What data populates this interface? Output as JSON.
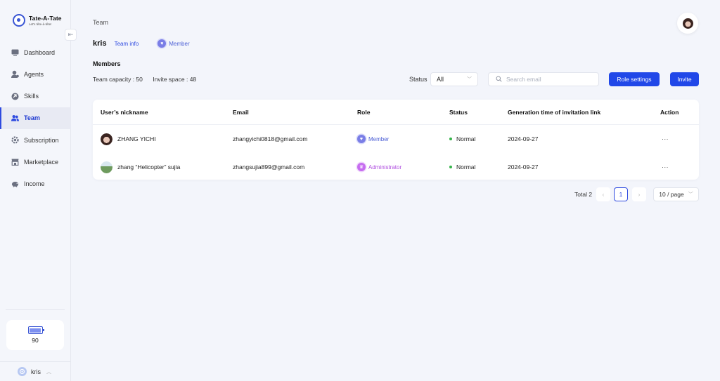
{
  "brand": {
    "title": "Tate-A-Tate",
    "subtitle": "Let's tête-à-tête!",
    "color": "#3a56d4"
  },
  "sidebar": {
    "items": [
      {
        "label": "Dashboard",
        "icon": "dashboard-icon"
      },
      {
        "label": "Agents",
        "icon": "agents-icon"
      },
      {
        "label": "Skills",
        "icon": "skills-icon"
      },
      {
        "label": "Team",
        "icon": "team-icon",
        "active": true
      },
      {
        "label": "Subscription",
        "icon": "subscription-icon"
      },
      {
        "label": "Marketplace",
        "icon": "marketplace-icon"
      },
      {
        "label": "Income",
        "icon": "income-icon"
      }
    ],
    "credits": "90",
    "user": "kris"
  },
  "header": {
    "breadcrumb": "Team"
  },
  "team": {
    "name": "kris",
    "info_link": "Team info",
    "role": "Member"
  },
  "members": {
    "title": "Members",
    "capacity": "Team capacity : 50",
    "invite_space": "Invite space : 48",
    "status_label": "Status",
    "status_value": "All",
    "search_placeholder": "Search email",
    "role_settings": "Role settings",
    "invite": "Invite"
  },
  "table": {
    "headers": {
      "nickname": "User’s nickname",
      "email": "Email",
      "role": "Role",
      "status": "Status",
      "generated": "Generation time of invitation link",
      "action": "Action"
    },
    "rows": [
      {
        "nickname": "ZHANG YICHI",
        "email": "zhangyichi0818@gmail.com",
        "role": "Member",
        "status": "Normal",
        "date": "2024-09-27",
        "action": "···"
      },
      {
        "nickname": "zhang “Helicopter” sujia",
        "email": "zhangsujia899@gmail.com",
        "role": "Administrator",
        "status": "Normal",
        "date": "2024-09-27",
        "action": "···"
      }
    ]
  },
  "pagination": {
    "total": "Total 2",
    "current": "1",
    "page_size": "10 / page"
  },
  "colors": {
    "primary": "#2148e8",
    "status_normal": "#35b44a",
    "admin": "#b04fe0",
    "member": "#4c5fd5"
  }
}
